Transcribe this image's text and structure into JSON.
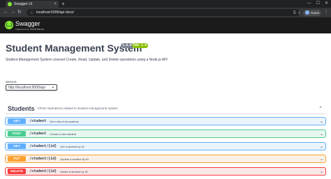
{
  "browser": {
    "tab_title": "Swagger UI",
    "tab_close": "×",
    "new_tab": "+",
    "url": "localhost:5000/api-docs/",
    "profile_label": "Guest"
  },
  "swagger": {
    "logo_name": "Swagger",
    "logo_sub": "supported by SMARTBEAR",
    "title": "Student Management System",
    "version_badge": "1.0.0",
    "oas_badge": "OAS 3.0",
    "description": "Student Management System covered Create, Read, Update, and Delete operations using a Node.js API",
    "servers_label": "Servers",
    "server_selected": "http://localhost:5000/api"
  },
  "tag": {
    "name": "Students",
    "description": "CRUD Operations related to student management system"
  },
  "operations": [
    {
      "method": "GET",
      "path": "/student",
      "summary": "Get a list of all students"
    },
    {
      "method": "POST",
      "path": "/student",
      "summary": "Create a new student"
    },
    {
      "method": "GET",
      "path": "/student/{id}",
      "summary": "Get a student by ID"
    },
    {
      "method": "PUT",
      "path": "/student/{id}",
      "summary": "Update a student by ID"
    },
    {
      "method": "DELETE",
      "path": "/student/{id}",
      "summary": "Delete a student by ID"
    }
  ],
  "colors": {
    "get": "#61affe",
    "post": "#49cc90",
    "put": "#fca130",
    "delete": "#f93e3e",
    "swagger_green": "#85ea2d"
  }
}
